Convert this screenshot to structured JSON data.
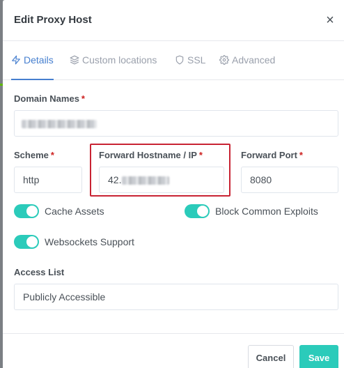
{
  "modal": {
    "title": "Edit Proxy Host",
    "close_glyph": "×"
  },
  "tabs": [
    {
      "label": "Details",
      "icon": "zap-icon",
      "active": true
    },
    {
      "label": "Custom locations",
      "icon": "layers-icon",
      "active": false
    },
    {
      "label": "SSL",
      "icon": "shield-icon",
      "active": false
    },
    {
      "label": "Advanced",
      "icon": "gear-icon",
      "active": false
    }
  ],
  "form": {
    "required_mark": "*",
    "domain_names": {
      "label": "Domain Names",
      "value_redacted": true
    },
    "scheme": {
      "label": "Scheme",
      "value": "http"
    },
    "forward_host": {
      "label": "Forward Hostname / IP",
      "value_visible": "42.",
      "value_redacted": true
    },
    "forward_port": {
      "label": "Forward Port",
      "value": "8080"
    },
    "toggles": {
      "cache_assets": {
        "label": "Cache Assets",
        "on": true
      },
      "block_exploits": {
        "label": "Block Common Exploits",
        "on": true
      },
      "websockets": {
        "label": "Websockets Support",
        "on": true
      }
    },
    "access_list": {
      "label": "Access List",
      "value": "Publicly Accessible"
    }
  },
  "footer": {
    "cancel_label": "Cancel",
    "save_label": "Save"
  },
  "colors": {
    "accent_blue": "#467fcf",
    "toggle_teal": "#2bcbba",
    "required_red": "#cd201f",
    "highlight_red": "#c82333"
  }
}
